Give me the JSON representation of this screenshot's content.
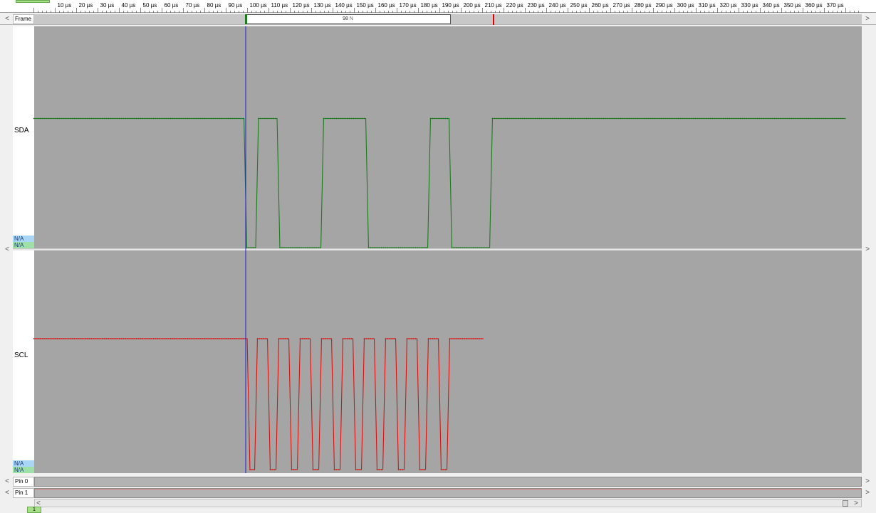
{
  "ruler": {
    "ticks": [
      "10 µs",
      "20 µs",
      "30 µs",
      "40 µs",
      "50 µs",
      "60 µs",
      "70 µs",
      "80 µs",
      "90 µs",
      "100 µs",
      "110 µs",
      "120 µs",
      "130 µs",
      "140 µs",
      "150 µs",
      "160 µs",
      "170 µs",
      "180 µs",
      "190 µs",
      "200 µs",
      "210 µs",
      "220 µs",
      "230 µs",
      "240 µs",
      "250 µs",
      "260 µs",
      "270 µs",
      "280 µs",
      "290 µs",
      "300 µs",
      "310 µs",
      "320 µs",
      "330 µs",
      "340 µs",
      "350 µs",
      "360 µs",
      "370 µs"
    ]
  },
  "frame_row": {
    "label": "Frame",
    "frame_value": "98",
    "frame_suffix": "N"
  },
  "channels": [
    {
      "name": "SDA",
      "color": "#1e7a1e",
      "na_top": "N/A",
      "na_bottom": "N/A",
      "segments_us": [
        [
          0,
          99,
          1
        ],
        [
          99,
          104.5,
          0
        ],
        [
          104.5,
          114.5,
          1
        ],
        [
          114.5,
          135,
          0
        ],
        [
          135,
          156,
          1
        ],
        [
          156,
          185,
          0
        ],
        [
          185,
          195,
          1
        ],
        [
          195,
          214,
          0
        ],
        [
          214,
          380,
          1
        ]
      ]
    },
    {
      "name": "SCL",
      "color": "#dd1010",
      "na_top": "N/A",
      "na_bottom": "N/A",
      "segments_us": [
        [
          0,
          100.5,
          1
        ],
        [
          100.5,
          104,
          0
        ],
        [
          104,
          110,
          1
        ],
        [
          110,
          114,
          0
        ],
        [
          114,
          120,
          1
        ],
        [
          120,
          124,
          0
        ],
        [
          124,
          130,
          1
        ],
        [
          130,
          134,
          0
        ],
        [
          134,
          140,
          1
        ],
        [
          140,
          144,
          0
        ],
        [
          144,
          150,
          1
        ],
        [
          150,
          154,
          0
        ],
        [
          154,
          160,
          1
        ],
        [
          160,
          164,
          0
        ],
        [
          164,
          170,
          1
        ],
        [
          170,
          174,
          0
        ],
        [
          174,
          180,
          1
        ],
        [
          180,
          184,
          0
        ],
        [
          184,
          190,
          1
        ],
        [
          190,
          194,
          0
        ],
        [
          194,
          210.5,
          1
        ]
      ]
    }
  ],
  "pins": [
    {
      "label": "Pin 0"
    },
    {
      "label": "Pin 1"
    }
  ],
  "nav": {
    "left_arrow": "<",
    "right_arrow": ">"
  },
  "page_tab": "1",
  "colors": {
    "plot_bg": "#a5a5a5",
    "cursor": "#2020d0",
    "marker": "#e00000"
  }
}
